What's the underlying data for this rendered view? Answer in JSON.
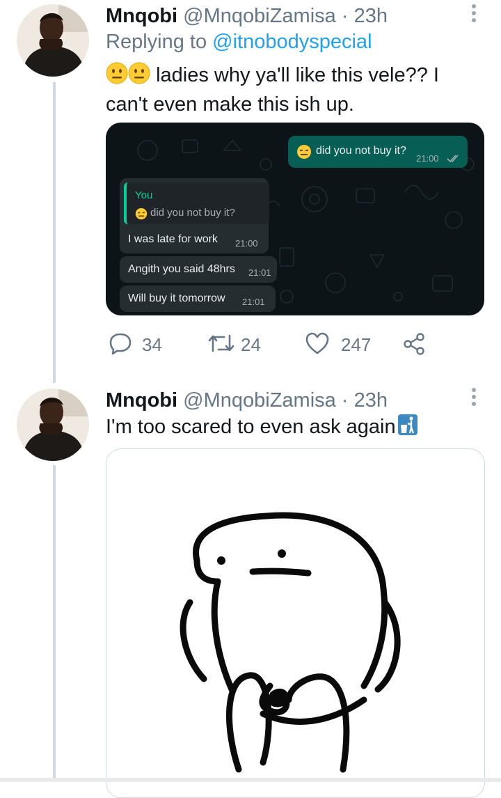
{
  "tweets": [
    {
      "author_name": "Mnqobi",
      "author_handle": "@MnqobiZamisa",
      "time": "23h",
      "separator": "·",
      "replying_to_prefix": "Replying to",
      "replying_to_handle": "@itnobodyspecial",
      "text_line1": "ladies why ya'll like this vele?? I",
      "text_line2": "can't even make this ish up.",
      "emojis": [
        "neutral-face",
        "neutral-face"
      ],
      "media": {
        "type": "whatsapp-chat-screenshot",
        "messages": [
          {
            "direction": "outgoing",
            "emoji": "expressionless-face",
            "text": "did you not buy it?",
            "time": "21:00",
            "status": "read-double-check"
          },
          {
            "direction": "incoming",
            "quote_author": "You",
            "quote_emoji": "expressionless-face",
            "quote_text": "did you not buy it?",
            "text": "I was late for work",
            "time": "21:00"
          },
          {
            "direction": "incoming",
            "text": "Angith you said 48hrs",
            "time": "21:01"
          },
          {
            "direction": "incoming",
            "text": "Will buy it tomorrow",
            "time": "21:01"
          }
        ]
      },
      "actions": {
        "reply_count": "34",
        "retweet_count": "24",
        "like_count": "247"
      }
    },
    {
      "author_name": "Mnqobi",
      "author_handle": "@MnqobiZamisa",
      "time": "23h",
      "separator": "·",
      "text": "I'm too scared to even ask again",
      "trailing_emoji": "put-litter-in-its-place",
      "media": {
        "type": "image",
        "description_icon": "scared-blob-meme"
      }
    }
  ],
  "colors": {
    "link": "#1da1f2",
    "secondary_text": "#657786",
    "thread_line": "#cfd9de",
    "wa_background": "#0d1418",
    "wa_outgoing": "#075e54",
    "wa_incoming": "#262d31"
  }
}
